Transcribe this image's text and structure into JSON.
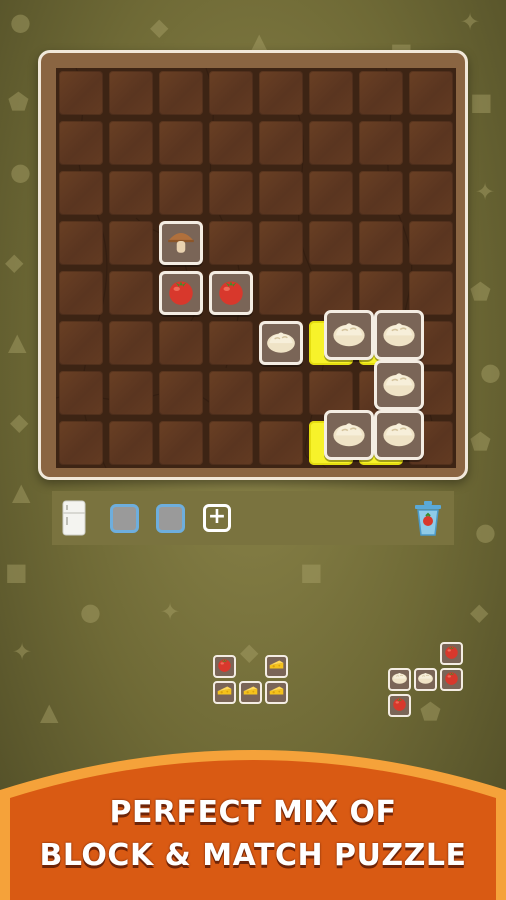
{
  "banner": {
    "line1": "PERFECT MIX OF",
    "line2": "BLOCK & MATCH PUZZLE"
  },
  "board": {
    "rows": 8,
    "cols": 8,
    "tiles": [
      {
        "row": 3,
        "col": 2,
        "item": "mushroom"
      },
      {
        "row": 4,
        "col": 2,
        "item": "tomato"
      },
      {
        "row": 4,
        "col": 3,
        "item": "tomato"
      },
      {
        "row": 5,
        "col": 4,
        "item": "bread"
      }
    ],
    "ghost_cells": [
      {
        "row": 5,
        "col": 5
      },
      {
        "row": 5,
        "col": 6
      },
      {
        "row": 7,
        "col": 5
      },
      {
        "row": 7,
        "col": 6
      }
    ],
    "held_piece": [
      {
        "row": 6,
        "col": 5,
        "item": "bread"
      },
      {
        "row": 6,
        "col": 6,
        "item": "bread"
      },
      {
        "row": 7,
        "col": 6,
        "item": "bread"
      },
      {
        "row": 8,
        "col": 5,
        "item": "bread"
      },
      {
        "row": 8,
        "col": 6,
        "item": "bread"
      }
    ]
  },
  "hotbar": {
    "left_icon": "fridge-icon",
    "slots": [
      "empty-slot",
      "empty-slot"
    ],
    "add_icon": "plus-icon",
    "right_icon": "trash-can-icon"
  },
  "pieces": [
    {
      "name": "piece-tomato-cheese",
      "cells": [
        {
          "r": 0,
          "c": 0,
          "item": "tomato"
        },
        {
          "r": 0,
          "c": 2,
          "item": "cheese"
        },
        {
          "r": 1,
          "c": 0,
          "item": "cheese"
        },
        {
          "r": 1,
          "c": 1,
          "item": "cheese"
        },
        {
          "r": 1,
          "c": 2,
          "item": "cheese"
        }
      ]
    },
    {
      "name": "piece-bread-tomato",
      "cells": [
        {
          "r": 0,
          "c": 2,
          "item": "tomato"
        },
        {
          "r": 1,
          "c": 0,
          "item": "bread"
        },
        {
          "r": 1,
          "c": 1,
          "item": "bread"
        },
        {
          "r": 1,
          "c": 2,
          "item": "tomato"
        },
        {
          "r": 2,
          "c": 0,
          "item": "tomato"
        }
      ]
    }
  ],
  "colors": {
    "banner_orange": "#d95a13",
    "banner_border": "#f5a23a",
    "ghost_yellow": "#f7f22a",
    "tile_frame": "#f4ede3",
    "slot_border": "#6eaedd"
  }
}
